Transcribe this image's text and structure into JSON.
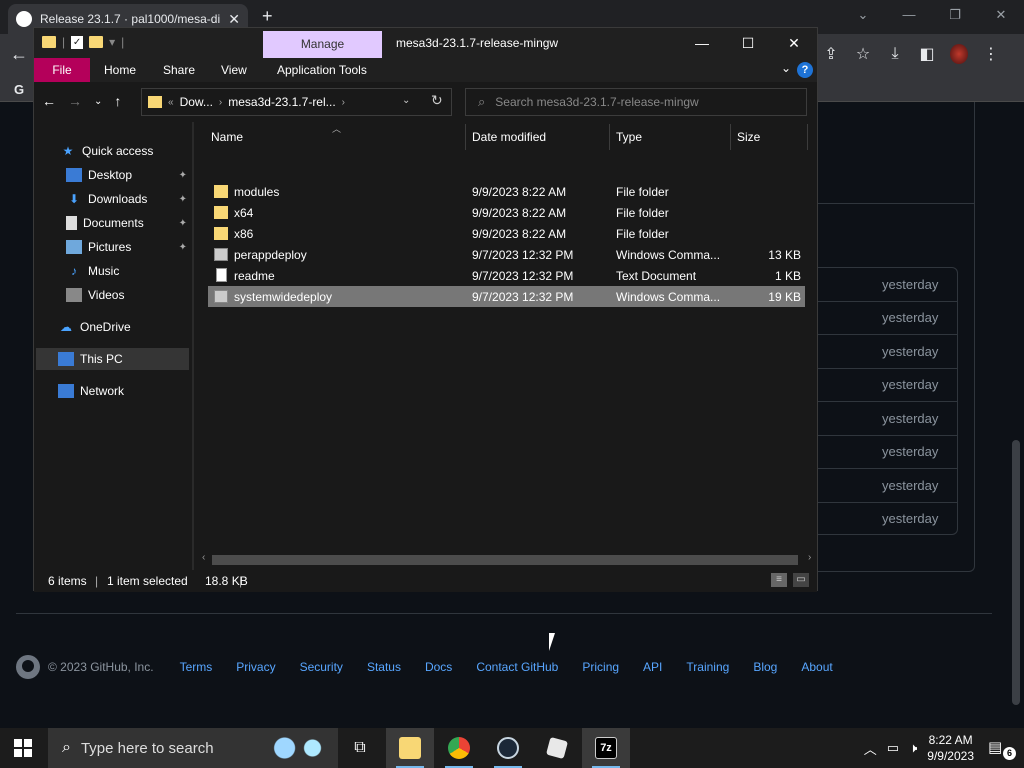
{
  "chrome": {
    "tab_title": "Release 23.1.7 · pal1000/mesa-di",
    "new_tab": "+",
    "tab_close": "✕",
    "window_controls": {
      "collapse": "⌄",
      "minimize": "—",
      "restore": "❐",
      "close": "✕"
    },
    "google_g": "G"
  },
  "github": {
    "yesterday_labels": [
      "yesterday",
      "yesterday",
      "yesterday",
      "yesterday",
      "yesterday",
      "yesterday",
      "yesterday",
      "yesterday"
    ],
    "footer": {
      "copyright": "© 2023 GitHub, Inc.",
      "links": [
        "Terms",
        "Privacy",
        "Security",
        "Status",
        "Docs",
        "Contact GitHub",
        "Pricing",
        "API",
        "Training",
        "Blog",
        "About"
      ]
    }
  },
  "explorer": {
    "manage_tab": "Manage",
    "title": "mesa3d-23.1.7-release-mingw",
    "window_controls": {
      "minimize": "—",
      "maximize": "☐",
      "close": "✕"
    },
    "ribbon_tabs": {
      "file": "File",
      "home": "Home",
      "share": "Share",
      "view": "View",
      "app_tools": "Application Tools"
    },
    "help": "?",
    "address": {
      "prefix": "«",
      "crumb1": "Dow...",
      "crumb2": "mesa3d-23.1.7-rel...",
      "sep": "›"
    },
    "search_placeholder": "Search mesa3d-23.1.7-release-mingw",
    "nav": {
      "quick_access": "Quick access",
      "desktop": "Desktop",
      "downloads": "Downloads",
      "documents": "Documents",
      "pictures": "Pictures",
      "music": "Music",
      "videos": "Videos",
      "onedrive": "OneDrive",
      "this_pc": "This PC",
      "network": "Network"
    },
    "columns": {
      "name": "Name",
      "date": "Date modified",
      "type": "Type",
      "size": "Size"
    },
    "files": [
      {
        "name": "modules",
        "date": "9/9/2023 8:22 AM",
        "type": "File folder",
        "size": ""
      },
      {
        "name": "x64",
        "date": "9/9/2023 8:22 AM",
        "type": "File folder",
        "size": ""
      },
      {
        "name": "x86",
        "date": "9/9/2023 8:22 AM",
        "type": "File folder",
        "size": ""
      },
      {
        "name": "perappdeploy",
        "date": "9/7/2023 12:32 PM",
        "type": "Windows Comma...",
        "size": "13 KB"
      },
      {
        "name": "readme",
        "date": "9/7/2023 12:32 PM",
        "type": "Text Document",
        "size": "1 KB"
      },
      {
        "name": "systemwidedeploy",
        "date": "9/7/2023 12:32 PM",
        "type": "Windows Comma...",
        "size": "19 KB"
      }
    ],
    "status": {
      "items": "6 items",
      "selected": "1 item selected",
      "size": "18.8 KB"
    }
  },
  "taskbar": {
    "search_placeholder": "Type here to search",
    "clock_time": "8:22 AM",
    "clock_date": "9/9/2023",
    "notification_count": "6",
    "sevenzip_label": "7z"
  }
}
